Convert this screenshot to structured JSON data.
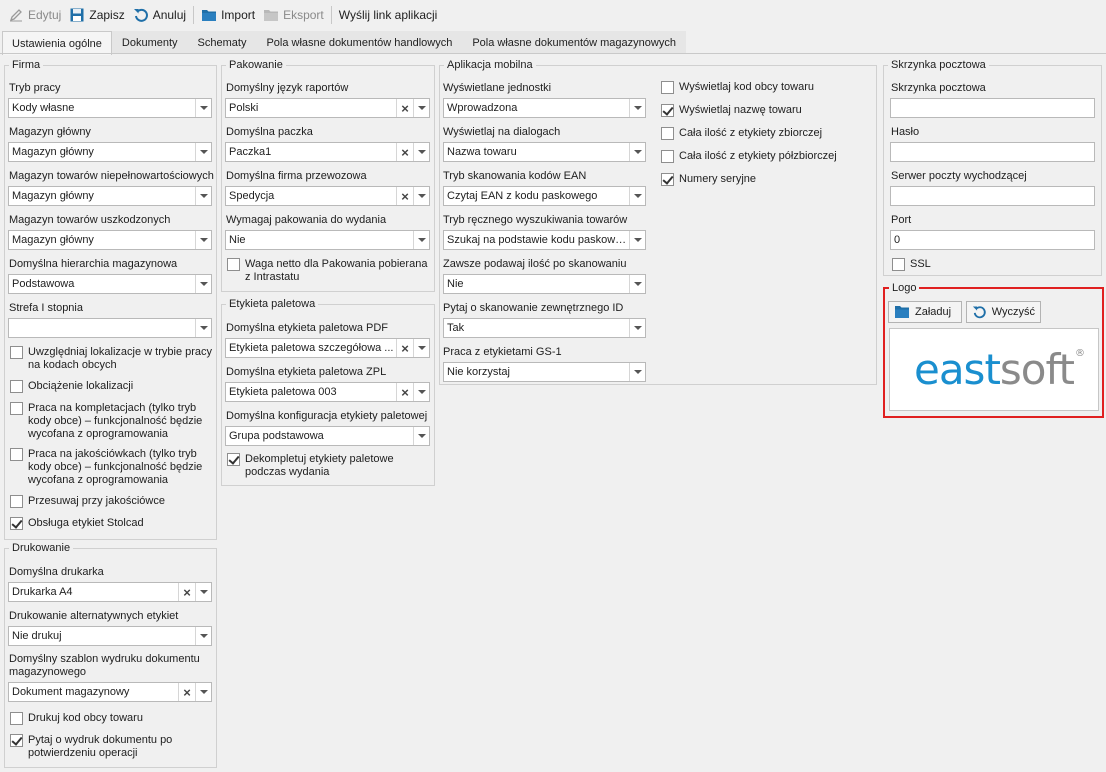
{
  "toolbar": {
    "edit": "Edytuj",
    "save": "Zapisz",
    "cancel": "Anuluj",
    "import": "Import",
    "export": "Eksport",
    "send_link": "Wyślij link aplikacji"
  },
  "tabs": [
    "Ustawienia ogólne",
    "Dokumenty",
    "Schematy",
    "Pola własne dokumentów handlowych",
    "Pola własne dokumentów magazynowych"
  ],
  "firma": {
    "legend": "Firma",
    "tryb_pracy_label": "Tryb pracy",
    "tryb_pracy": "Kody własne",
    "magazyn_glowny_label": "Magazyn główny",
    "magazyn_glowny": "Magazyn główny",
    "mag_niepelnowart_label": "Magazyn towarów niepełnowartościowych",
    "mag_niepelnowart": "Magazyn główny",
    "mag_uszkodzonych_label": "Magazyn towarów uszkodzonych",
    "mag_uszkodzonych": "Magazyn główny",
    "hierarchia_label": "Domyślna hierarchia magazynowa",
    "hierarchia": "Podstawowa",
    "strefa_label": "Strefa I stopnia",
    "strefa": "",
    "checks": [
      {
        "label": "Uwzględniaj lokalizacje w trybie pracy na kodach obcych",
        "checked": false
      },
      {
        "label": "Obciążenie lokalizacji",
        "checked": false
      },
      {
        "label": "Praca na kompletacjach (tylko tryb kody obce) – funkcjonalność będzie wycofana z oprogramowania",
        "checked": false
      },
      {
        "label": "Praca na jakościówkach (tylko tryb kody obce) – funkcjonalność będzie wycofana z oprogramowania",
        "checked": false
      },
      {
        "label": "Przesuwaj przy jakościówce",
        "checked": false
      },
      {
        "label": "Obsługa etykiet Stolcad",
        "checked": true
      }
    ]
  },
  "drukowanie": {
    "legend": "Drukowanie",
    "drukarka_label": "Domyślna drukarka",
    "drukarka": "Drukarka A4",
    "alt_label": "Drukowanie alternatywnych etykiet",
    "alt": "Nie drukuj",
    "szablon_label": "Domyślny szablon wydruku dokumentu magazynowego",
    "szablon": "Dokument magazynowy",
    "checks": [
      {
        "label": "Drukuj kod obcy towaru",
        "checked": false
      },
      {
        "label": "Pytaj o wydruk dokumentu po potwierdzeniu operacji",
        "checked": true
      }
    ]
  },
  "pakowanie": {
    "legend": "Pakowanie",
    "jezyk_label": "Domyślny język raportów",
    "jezyk": "Polski",
    "paczka_label": "Domyślna paczka",
    "paczka": "Paczka1",
    "firma_label": "Domyślna firma przewozowa",
    "firma": "Spedycja",
    "wymagaj_label": "Wymagaj pakowania do wydania",
    "wymagaj": "Nie",
    "waga_check": {
      "label": "Waga netto dla Pakowania pobierana z Intrastatu",
      "checked": false
    }
  },
  "etykieta": {
    "legend": "Etykieta paletowa",
    "pdf_label": "Domyślna etykieta paletowa PDF",
    "pdf": "Etykieta paletowa szczegółowa ...",
    "zpl_label": "Domyślna etykieta paletowa ZPL",
    "zpl": "Etykieta paletowa 003",
    "konf_label": "Domyślna konfiguracja etykiety paletowej",
    "konf": "Grupa podstawowa",
    "dekompletuj": {
      "label": "Dekompletuj etykiety paletowe podczas wydania",
      "checked": true
    }
  },
  "mobile": {
    "legend": "Aplikacja mobilna",
    "jednostki_label": "Wyświetlane jednostki",
    "jednostki": "Wprowadzona",
    "dialogi_label": "Wyświetlaj na dialogach",
    "dialogi": "Nazwa towaru",
    "ean_label": "Tryb skanowania kodów EAN",
    "ean": "Czytaj EAN z kodu paskowego",
    "reczny_label": "Tryb ręcznego wyszukiwania towarów",
    "reczny": "Szukaj na podstawie kodu paskowe...",
    "ilosc_label": "Zawsze podawaj ilość po skanowaniu",
    "ilosc": "Nie",
    "zewn_label": "Pytaj o skanowanie zewnętrznego ID",
    "zewn": "Tak",
    "gs1_label": "Praca z etykietami GS-1",
    "gs1": "Nie korzystaj",
    "checks": [
      {
        "label": "Wyświetlaj kod obcy towaru",
        "checked": false
      },
      {
        "label": "Wyświetlaj nazwę towaru",
        "checked": true
      },
      {
        "label": "Cała ilość z etykiety zbiorczej",
        "checked": false
      },
      {
        "label": "Cała ilość z etykiety półzbiorczej",
        "checked": false
      },
      {
        "label": "Numery seryjne",
        "checked": true
      }
    ]
  },
  "mail": {
    "legend": "Skrzynka pocztowa",
    "skrzynka_label": "Skrzynka pocztowa",
    "skrzynka": "",
    "haslo_label": "Hasło",
    "haslo": "",
    "serwer_label": "Serwer poczty wychodzącej",
    "serwer": "",
    "port_label": "Port",
    "port": "0",
    "ssl": {
      "label": "SSL",
      "checked": false
    }
  },
  "logo": {
    "legend": "Logo",
    "load": "Załaduj",
    "clear": "Wyczyść",
    "brand_a": "east",
    "brand_b": "soft",
    "reg": "®"
  },
  "colors": {
    "highlight": "#e02020",
    "brand_blue": "#1a8fcf",
    "brand_gray": "#8a8a8a"
  }
}
